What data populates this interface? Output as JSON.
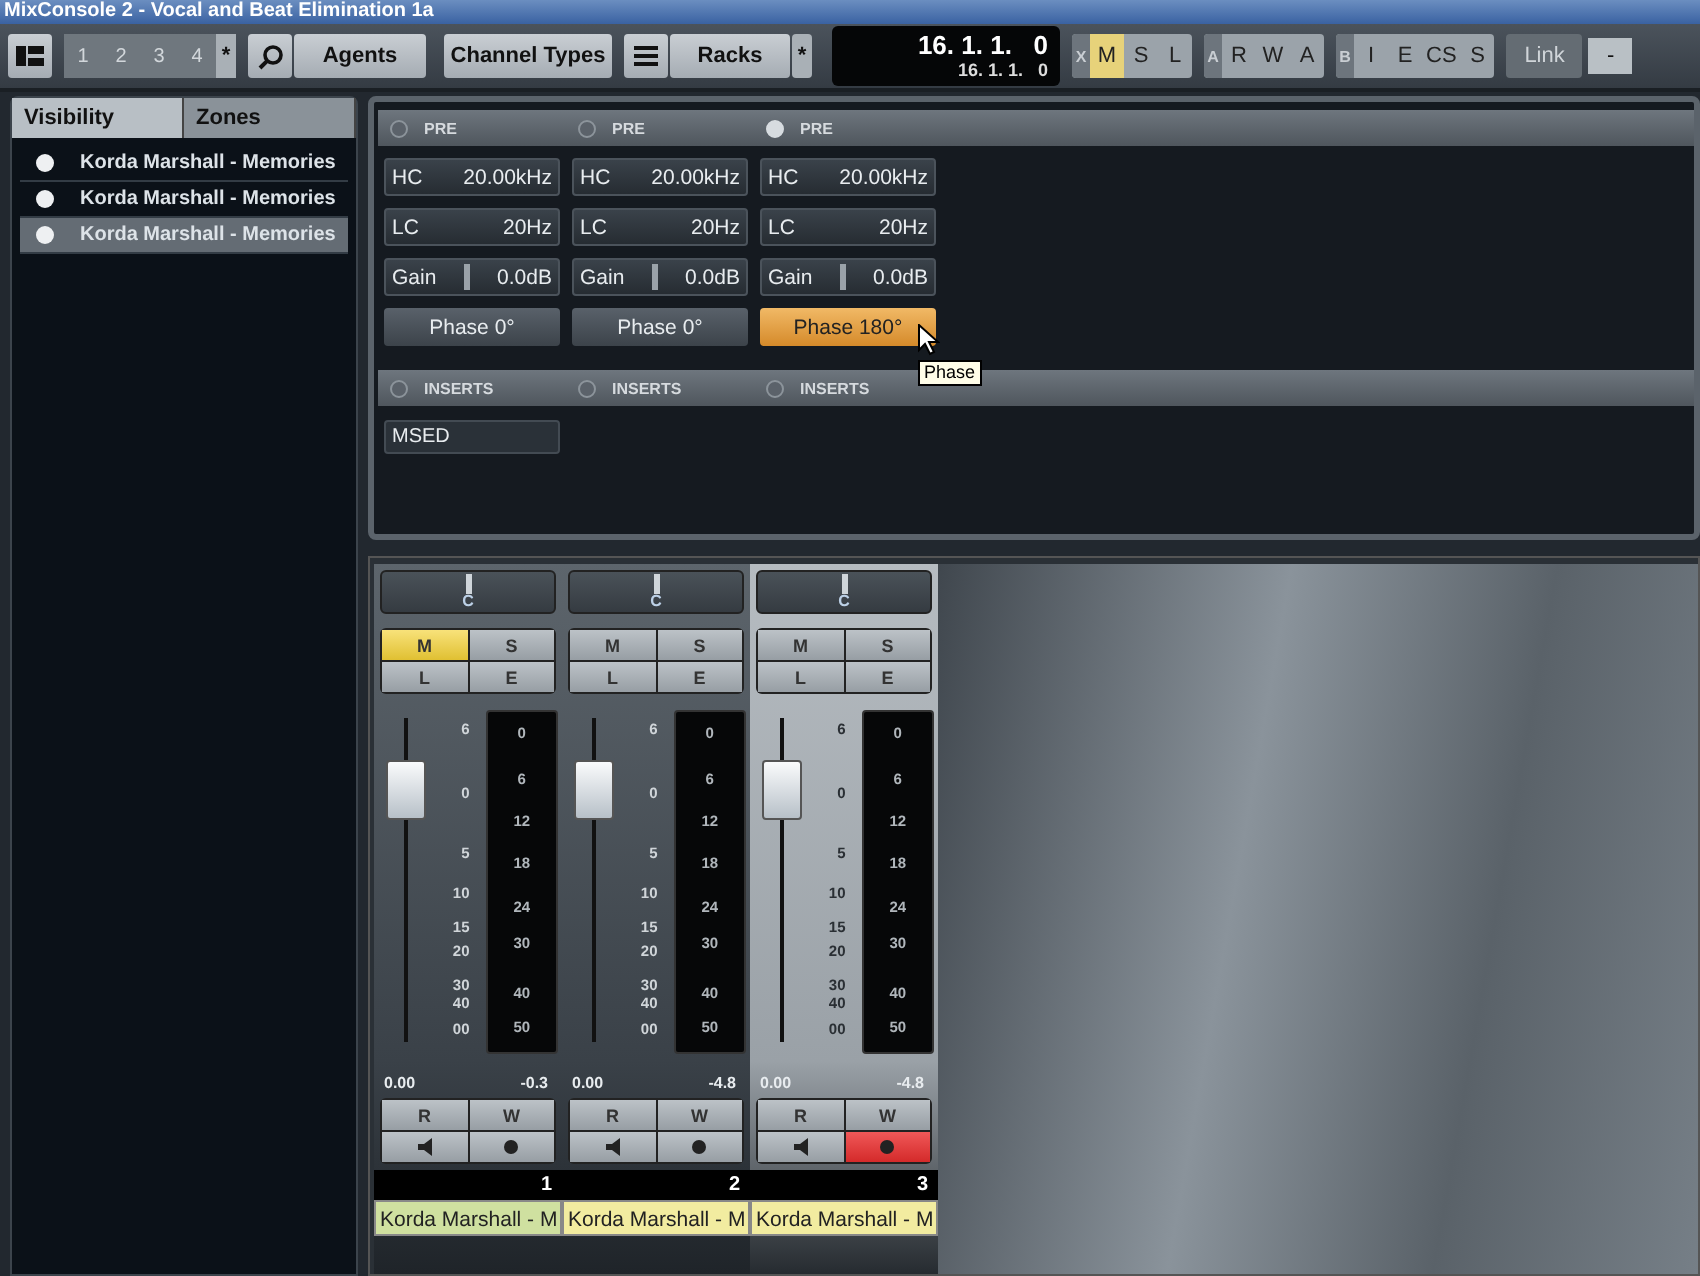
{
  "window": {
    "title": "MixConsole 2 - Vocal and Beat Elimination 1a"
  },
  "toolbar": {
    "pages": [
      {
        "label": "1",
        "disabled": true
      },
      {
        "label": "2",
        "disabled": true
      },
      {
        "label": "3",
        "disabled": true
      },
      {
        "label": "4",
        "disabled": true
      }
    ],
    "pages_star": "*",
    "agents": "Agents",
    "channel_types": "Channel Types",
    "racks": "Racks",
    "racks_star": "*",
    "time_main": "16. 1. 1.   0",
    "time_sub": "16. 1. 1.   0",
    "groups": [
      {
        "tag": "X",
        "buttons": [
          {
            "label": "M",
            "selected": true
          },
          {
            "label": "S",
            "selected": false
          },
          {
            "label": "L",
            "selected": false
          }
        ]
      },
      {
        "tag": "A",
        "buttons": [
          {
            "label": "R",
            "selected": false
          },
          {
            "label": "W",
            "selected": false
          },
          {
            "label": "A",
            "selected": false
          }
        ]
      },
      {
        "tag": "B",
        "buttons": [
          {
            "label": "I",
            "selected": false
          },
          {
            "label": "E",
            "selected": false
          },
          {
            "label": "CS",
            "selected": false
          },
          {
            "label": "S",
            "selected": false
          }
        ]
      }
    ],
    "link": {
      "label": "Link",
      "disabled": true
    },
    "link_menu": "-"
  },
  "sidebar": {
    "tabs": [
      {
        "label": "Visibility",
        "selected": true
      },
      {
        "label": "Zones",
        "selected": false
      }
    ],
    "items": [
      {
        "label": "Korda Marshall - Memories",
        "selected": false
      },
      {
        "label": "Korda Marshall - Memories",
        "selected": false
      },
      {
        "label": "Korda Marshall - Memories",
        "selected": true
      }
    ]
  },
  "tooltip": "Phase",
  "channels": [
    {
      "pre_label": "PRE",
      "pre_on": false,
      "hc_label": "HC",
      "hc": "20.00kHz",
      "lc_label": "LC",
      "lc": "20Hz",
      "gain_label": "Gain",
      "gain": "0.0dB",
      "phase": "Phase 0°",
      "phase_on": false,
      "inserts_label": "INSERTS",
      "inserts": [
        "MSED"
      ],
      "pan": "C",
      "selected": false,
      "mute": {
        "label": "M",
        "on": true
      },
      "solo": {
        "label": "S",
        "on": false
      },
      "listen": {
        "label": "L",
        "on": false
      },
      "edit": {
        "label": "E",
        "on": false
      },
      "fader_scale": [
        "6",
        "0",
        "5",
        "10",
        "15",
        "20",
        "30",
        "40",
        "00"
      ],
      "meter_scale": [
        "0",
        "6",
        "12",
        "18",
        "24",
        "30",
        "40",
        "50"
      ],
      "level": 0.78,
      "fader_value": "0.00",
      "meter_value": "-0.3",
      "read": {
        "label": "R",
        "on": false
      },
      "write": {
        "label": "W",
        "on": false
      },
      "monitor_on": false,
      "record_on": false,
      "number": "1",
      "name": "Korda Marshall - M",
      "color": "#cfe0a0"
    },
    {
      "pre_label": "PRE",
      "pre_on": false,
      "hc_label": "HC",
      "hc": "20.00kHz",
      "lc_label": "LC",
      "lc": "20Hz",
      "gain_label": "Gain",
      "gain": "0.0dB",
      "phase": "Phase 0°",
      "phase_on": false,
      "inserts_label": "INSERTS",
      "pan": "C",
      "selected": false,
      "mute": {
        "label": "M",
        "on": false
      },
      "solo": {
        "label": "S",
        "on": false
      },
      "listen": {
        "label": "L",
        "on": false
      },
      "edit": {
        "label": "E",
        "on": false
      },
      "fader_scale": [
        "6",
        "0",
        "5",
        "10",
        "15",
        "20",
        "30",
        "40",
        "00"
      ],
      "meter_scale": [
        "0",
        "6",
        "12",
        "18",
        "24",
        "30",
        "40",
        "50"
      ],
      "level": 0.78,
      "fader_value": "0.00",
      "meter_value": "-4.8",
      "read": {
        "label": "R",
        "on": false
      },
      "write": {
        "label": "W",
        "on": false
      },
      "monitor_on": false,
      "record_on": false,
      "number": "2",
      "name": "Korda Marshall - M",
      "color": "#f2eca0"
    },
    {
      "pre_label": "PRE",
      "pre_on": true,
      "hc_label": "HC",
      "hc": "20.00kHz",
      "lc_label": "LC",
      "lc": "20Hz",
      "gain_label": "Gain",
      "gain": "0.0dB",
      "phase": "Phase 180°",
      "phase_on": true,
      "inserts_label": "INSERTS",
      "pan": "C",
      "selected": true,
      "mute": {
        "label": "M",
        "on": false
      },
      "solo": {
        "label": "S",
        "on": false
      },
      "listen": {
        "label": "L",
        "on": false
      },
      "edit": {
        "label": "E",
        "on": false
      },
      "fader_scale": [
        "6",
        "0",
        "5",
        "10",
        "15",
        "20",
        "30",
        "40",
        "00"
      ],
      "meter_scale": [
        "0",
        "6",
        "12",
        "18",
        "24",
        "30",
        "40",
        "50"
      ],
      "level": 0.78,
      "fader_value": "0.00",
      "meter_value": "-4.8",
      "read": {
        "label": "R",
        "on": false
      },
      "write": {
        "label": "W",
        "on": false
      },
      "monitor_on": false,
      "record_on": true,
      "number": "3",
      "name": "Korda Marshall - M",
      "color": "#f2eca0"
    }
  ]
}
